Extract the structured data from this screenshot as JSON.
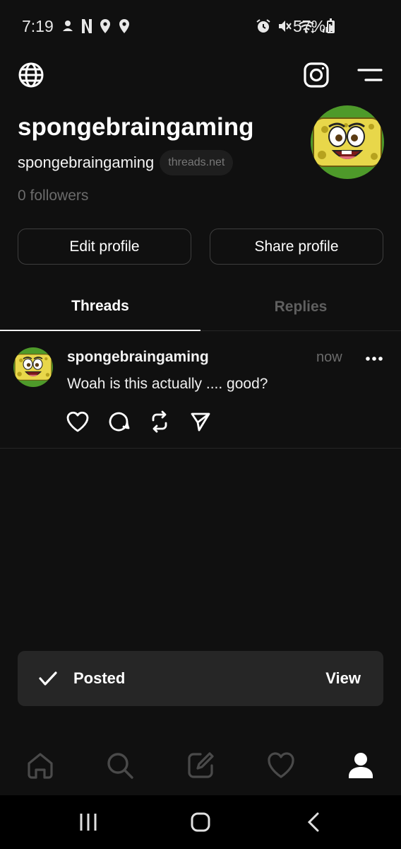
{
  "status_bar": {
    "time": "7:19",
    "battery": "57%",
    "left_icons": [
      "notification-icon",
      "netflix-icon",
      "location-icon",
      "location-icon"
    ],
    "right_icons": [
      "alarm-icon",
      "mute-icon",
      "wifi-icon",
      "signal-icon"
    ]
  },
  "header": {
    "left_icon": "globe-icon",
    "right_icons": [
      "instagram-icon",
      "menu-icon"
    ]
  },
  "profile": {
    "display_name": "spongebraingaming",
    "username": "spongebraingaming",
    "domain": "threads.net",
    "followers": "0 followers",
    "edit_label": "Edit profile",
    "share_label": "Share profile"
  },
  "tabs": [
    {
      "label": "Threads",
      "active": true
    },
    {
      "label": "Replies",
      "active": false
    }
  ],
  "post": {
    "username": "spongebraingaming",
    "time": "now",
    "text": "Woah is this actually .... good?",
    "actions": [
      "heart-icon",
      "comment-icon",
      "repost-icon",
      "share-icon"
    ]
  },
  "toast": {
    "message": "Posted",
    "action": "View"
  },
  "bottom_nav": [
    "home-icon",
    "search-icon",
    "compose-icon",
    "activity-icon",
    "profile-icon"
  ],
  "colors": {
    "background": "#101010",
    "text": "#ffffff",
    "muted": "#6b6b6b",
    "toast": "#262626",
    "avatar_yellow": "#e8d74a",
    "avatar_green": "#4e9a2a"
  }
}
